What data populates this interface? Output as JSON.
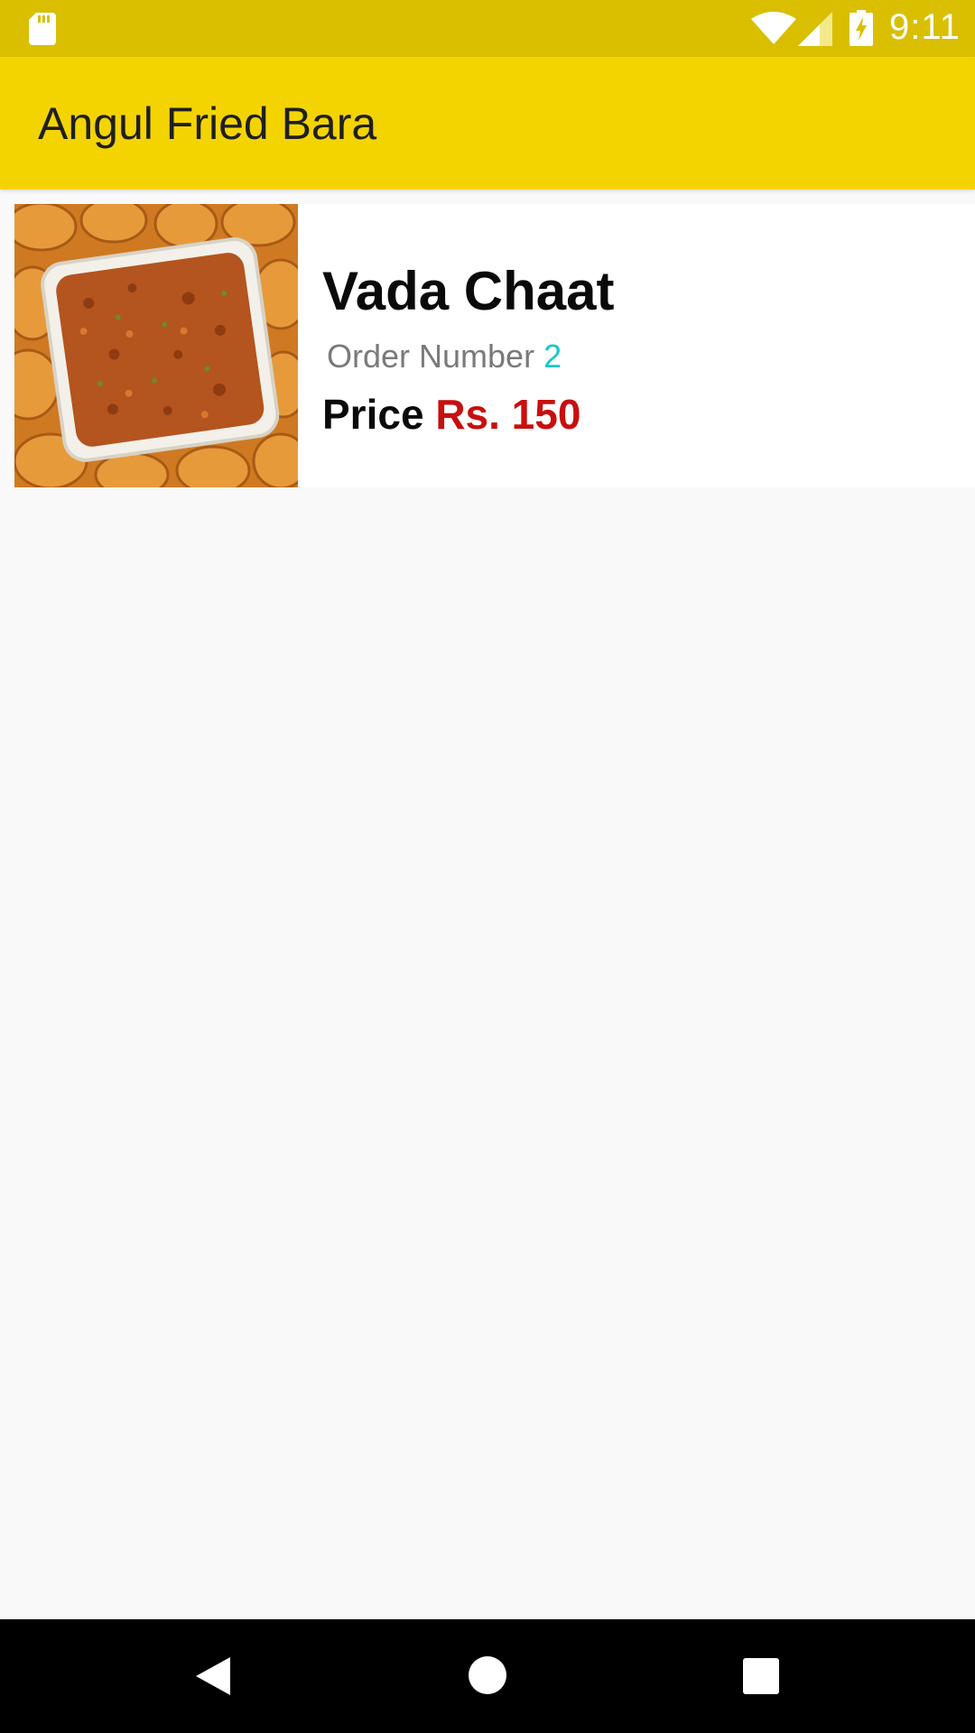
{
  "status_bar": {
    "time": "9:11",
    "icons": [
      "sd-card-icon",
      "wifi-icon",
      "signal-icon",
      "battery-charging-icon"
    ],
    "background": "#d9bf00"
  },
  "app_bar": {
    "title": "Angul Fried Bara",
    "background": "#f4d400"
  },
  "items": [
    {
      "name": "Vada Chaat",
      "order_label": "Order Number",
      "order_number": "2",
      "price_label": "Price",
      "price_value": "Rs. 150",
      "image_icon": "vada-chaat-photo"
    }
  ],
  "nav_bar": {
    "buttons": [
      "back-icon",
      "home-icon",
      "recents-icon"
    ]
  },
  "colors": {
    "order_number": "#19c8c8",
    "price_value": "#c80f0f"
  }
}
